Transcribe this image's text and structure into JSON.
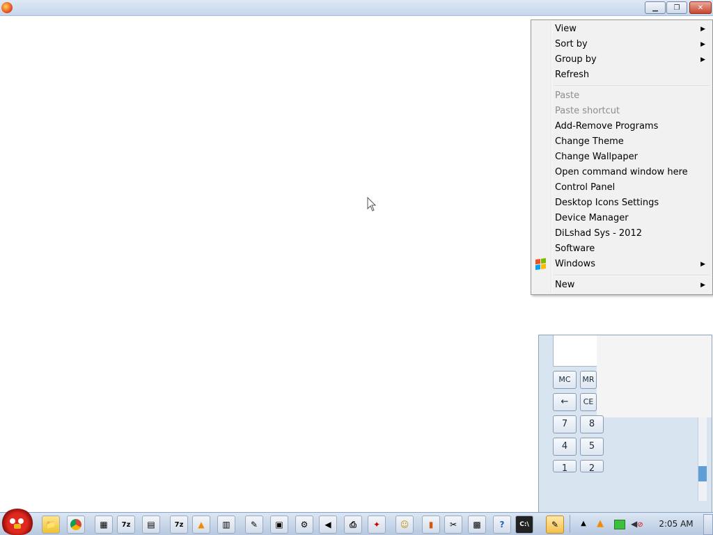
{
  "context_menu": {
    "items": [
      {
        "label": "View",
        "submenu": true,
        "enabled": true
      },
      {
        "label": "Sort by",
        "submenu": true,
        "enabled": true
      },
      {
        "label": "Group by",
        "submenu": true,
        "enabled": true
      },
      {
        "label": "Refresh",
        "submenu": false,
        "enabled": true
      },
      {
        "label": "Paste",
        "submenu": false,
        "enabled": false
      },
      {
        "label": "Paste shortcut",
        "submenu": false,
        "enabled": false
      },
      {
        "label": "Add-Remove Programs",
        "submenu": false,
        "enabled": true
      },
      {
        "label": "Change Theme",
        "submenu": false,
        "enabled": true
      },
      {
        "label": "Change Wallpaper",
        "submenu": false,
        "enabled": true
      },
      {
        "label": "Open command window here",
        "submenu": false,
        "enabled": true
      },
      {
        "label": "Control Panel",
        "submenu": false,
        "enabled": true
      },
      {
        "label": "Desktop Icons Settings",
        "submenu": false,
        "enabled": true
      },
      {
        "label": "Device Manager",
        "submenu": false,
        "enabled": true
      },
      {
        "label": "DiLshad Sys - 2012",
        "submenu": false,
        "enabled": true
      },
      {
        "label": "Software",
        "submenu": false,
        "enabled": true
      },
      {
        "label": "Windows",
        "submenu": true,
        "enabled": true,
        "icon": "windows-flag-icon"
      },
      {
        "label": "New",
        "submenu": true,
        "enabled": true
      }
    ]
  },
  "calculator": {
    "buttons": [
      "MC",
      "MR",
      "←",
      "CE",
      "7",
      "8",
      "4",
      "5",
      "1",
      "2"
    ]
  },
  "taskbar": {
    "clock": "2:05 AM",
    "pinned_icons": [
      "angry-birds-start-icon",
      "folder-icon",
      "chrome-icon",
      "media-icon",
      "7zip-icon",
      "notepad-icon",
      "7zip-icon",
      "vlc-icon",
      "calculator-icon",
      "paint-icon",
      "monitor-icon",
      "settings-icon",
      "volume-icon",
      "printer-icon",
      "pdf-icon",
      "messenger-icon",
      "bookmark-icon",
      "tools-icon",
      "floppy-icon",
      "help-icon",
      "cmd-icon",
      "explorer-icon"
    ],
    "tray_icons": [
      "show-hidden-icons-icon",
      "vlc-tray-icon",
      "network-icon",
      "volume-muted-icon"
    ]
  },
  "colors": {
    "menu_bg": "#f1f1f1",
    "taskbar_bg": "#c6d5e8",
    "accent_red": "#c8462f"
  }
}
